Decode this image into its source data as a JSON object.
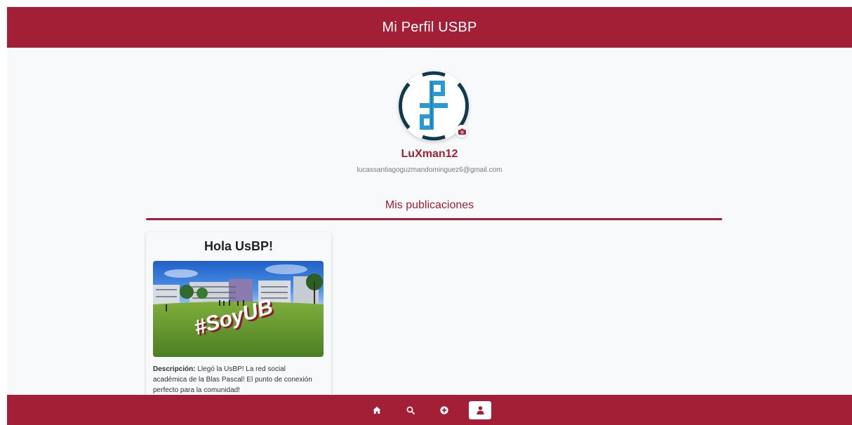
{
  "header": {
    "title": "Mi Perfil USBP"
  },
  "profile": {
    "avatar_icon": "usbp-logo",
    "change_photo_icon": "camera-icon",
    "username": "LuXman12",
    "email": "lucassantiagoguzmandominguez6@gmail.com"
  },
  "publications": {
    "section_title": "Mis publicaciones",
    "posts": [
      {
        "title": "Hola UsBP!",
        "image_text": "#SoyUB",
        "description_label": "Descripción:",
        "description": " Llegó la UsBP! La red social académica de la Blas Pascal! El punto de conexión perfecto para la comunidad!"
      }
    ]
  },
  "bottom_nav": {
    "items": [
      {
        "icon": "home-icon",
        "active": false
      },
      {
        "icon": "search-icon",
        "active": false
      },
      {
        "icon": "add-circle-icon",
        "active": false
      },
      {
        "icon": "user-icon",
        "active": true
      }
    ]
  },
  "colors": {
    "brand": "#a21f36",
    "background": "#f8f9fa",
    "logo_blue": "#2a9ad4",
    "logo_dark": "#0f3a4a"
  }
}
